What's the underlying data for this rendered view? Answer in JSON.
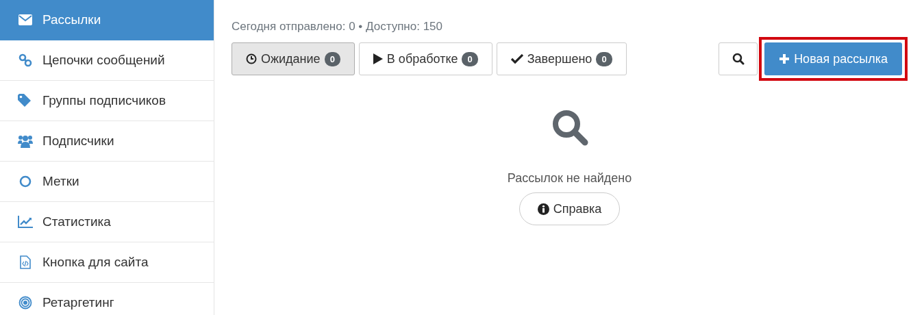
{
  "sidebar": {
    "items": [
      {
        "label": "Рассылки",
        "kind": "envelope",
        "selected": true
      },
      {
        "label": "Цепочки сообщений",
        "kind": "link",
        "selected": false
      },
      {
        "label": "Группы подписчиков",
        "kind": "tags",
        "selected": false
      },
      {
        "label": "Подписчики",
        "kind": "users",
        "selected": false
      },
      {
        "label": "Метки",
        "kind": "circle",
        "selected": false
      },
      {
        "label": "Статистика",
        "kind": "chart",
        "selected": false
      },
      {
        "label": "Кнопка для сайта",
        "kind": "code",
        "selected": false
      },
      {
        "label": "Ретаргетинг",
        "kind": "target",
        "selected": false
      }
    ]
  },
  "stats": "Сегодня отправлено: 0 • Доступно: 150",
  "tabs": [
    {
      "label": "Ожидание",
      "kind": "clock",
      "count": "0",
      "selected": true
    },
    {
      "label": "В обработке",
      "kind": "play",
      "count": "0",
      "selected": false
    },
    {
      "label": "Завершено",
      "kind": "check",
      "count": "0",
      "selected": false
    }
  ],
  "new_button": {
    "label": "Новая рассылка",
    "highlighted": true
  },
  "empty_state": {
    "message": "Рассылок не найдено",
    "help_button": "Справка"
  }
}
